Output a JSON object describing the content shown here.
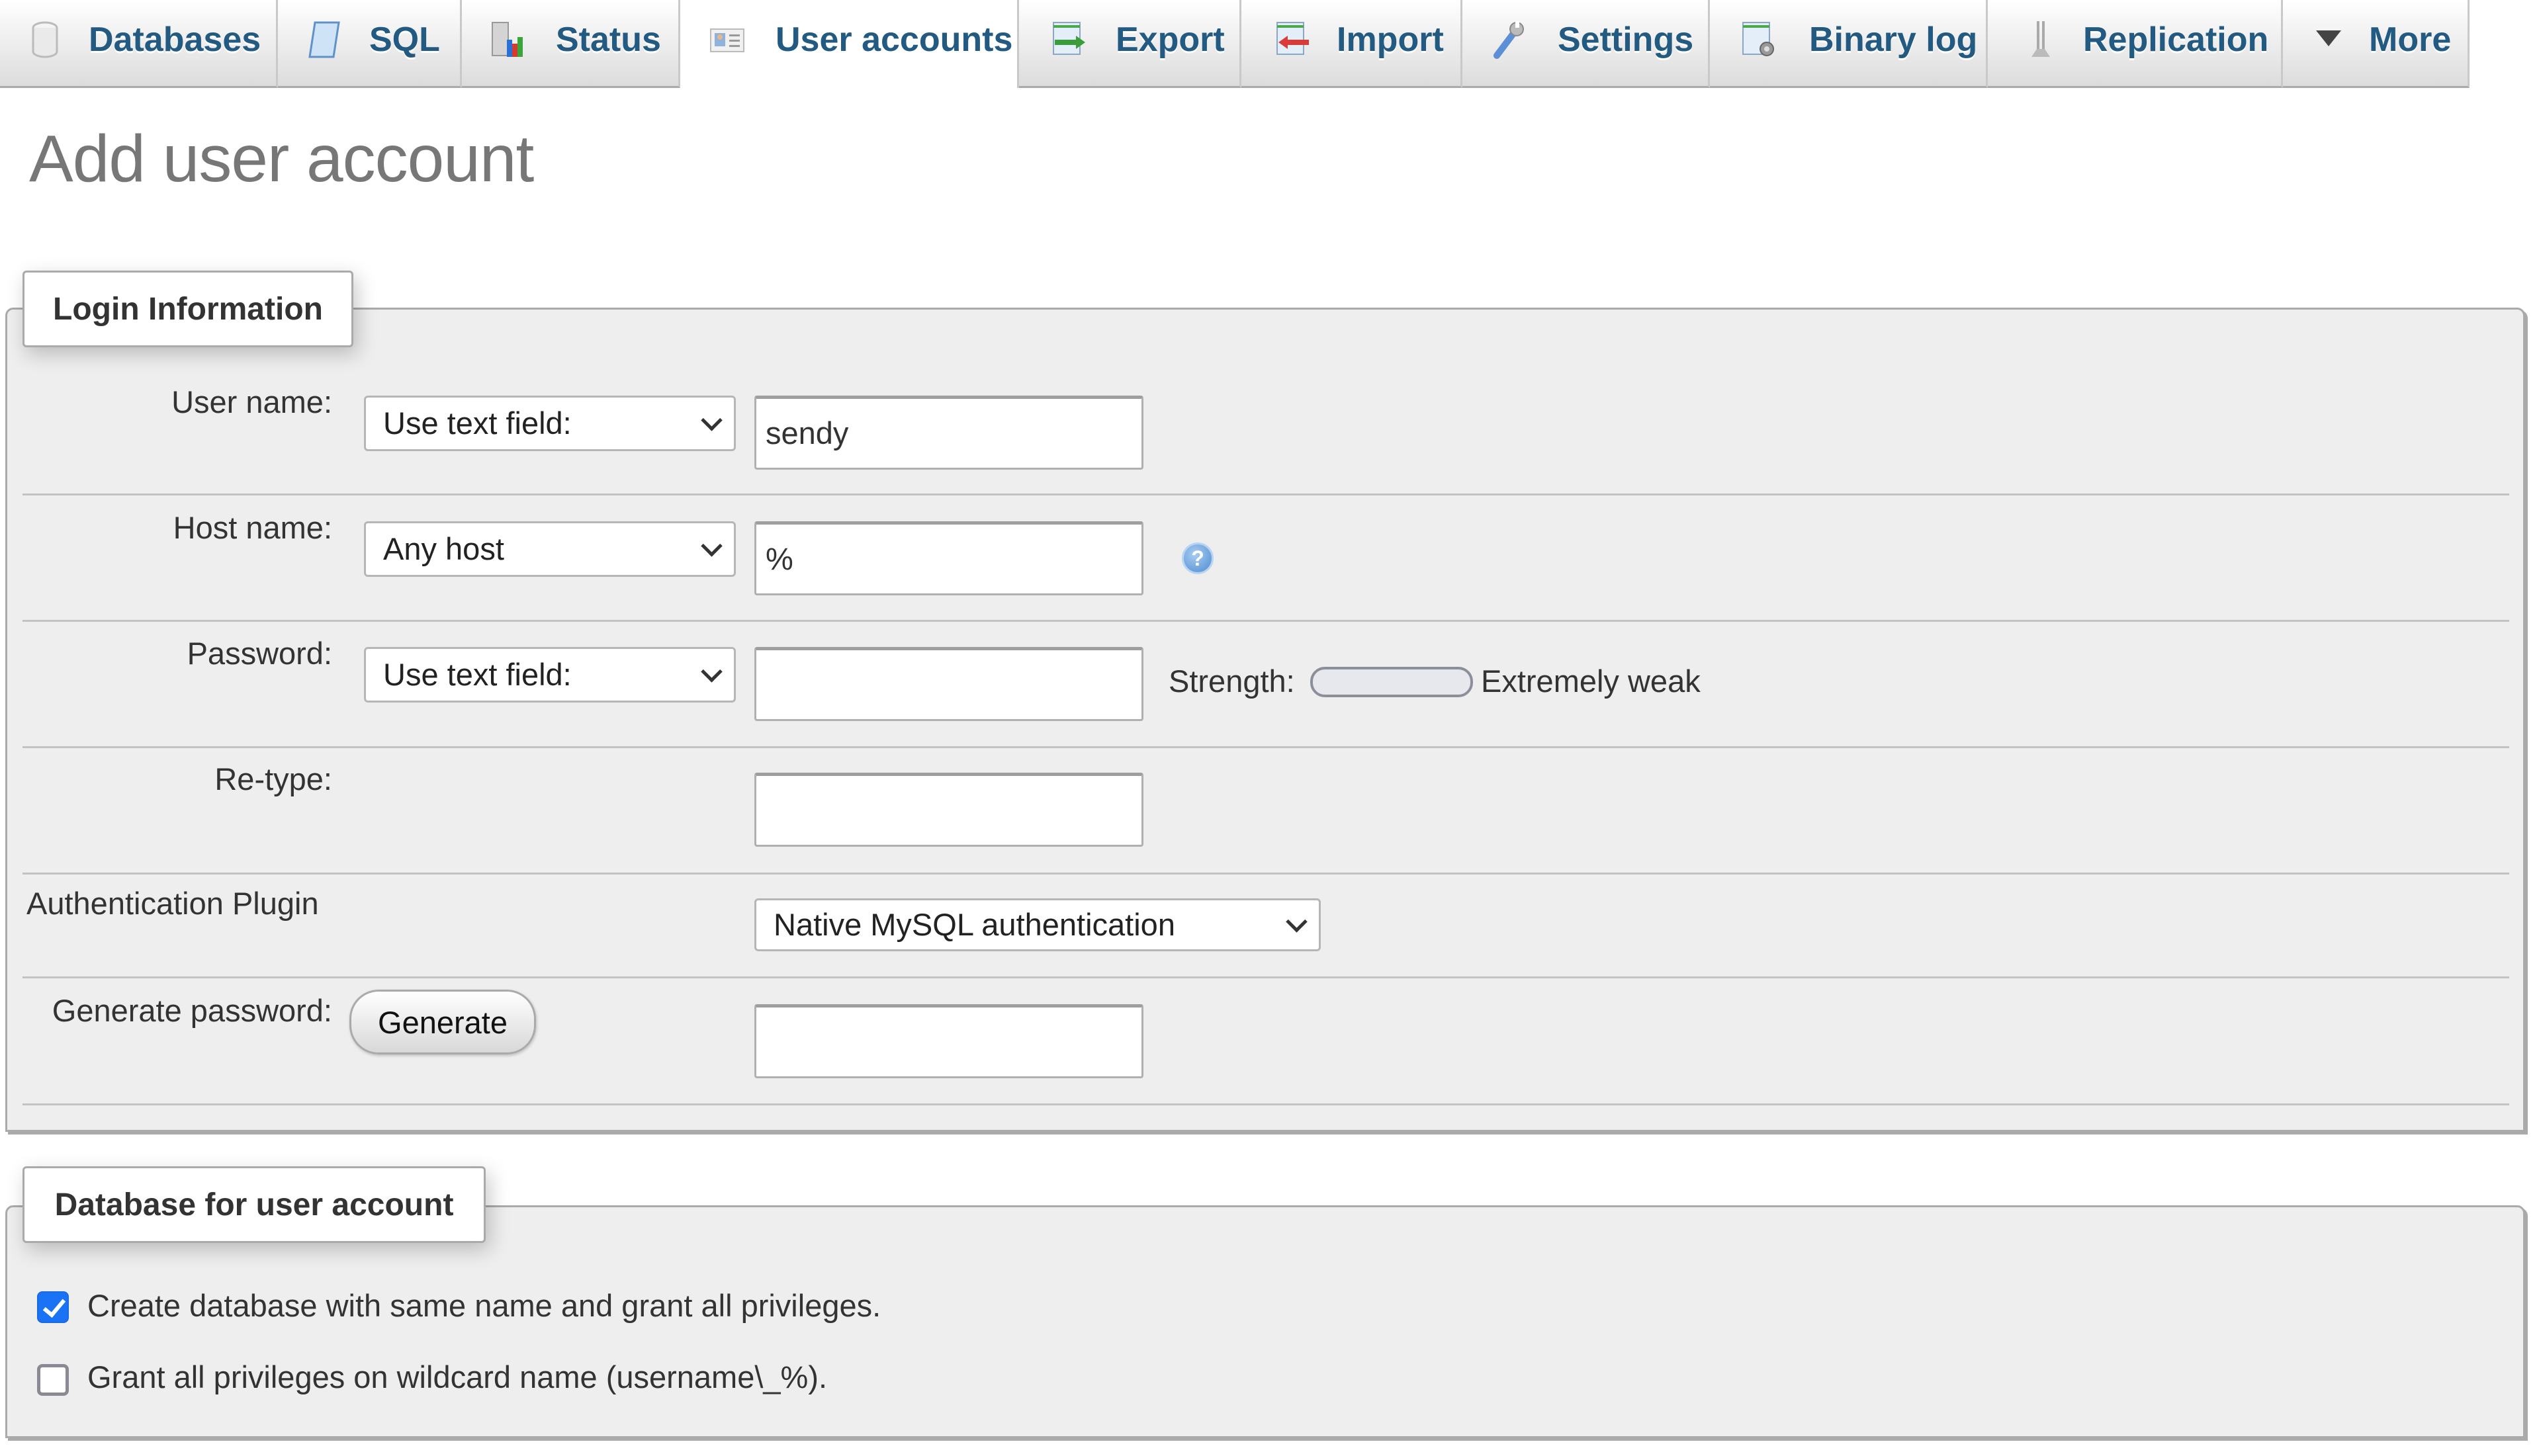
{
  "tabs": [
    {
      "label": "Databases",
      "icon": "database-icon",
      "active": false
    },
    {
      "label": "SQL",
      "icon": "sql-scroll-icon",
      "active": false
    },
    {
      "label": "Status",
      "icon": "status-chart-icon",
      "active": false
    },
    {
      "label": "User accounts",
      "icon": "user-card-icon",
      "active": true
    },
    {
      "label": "Export",
      "icon": "export-icon",
      "active": false
    },
    {
      "label": "Import",
      "icon": "import-icon",
      "active": false
    },
    {
      "label": "Settings",
      "icon": "wrench-icon",
      "active": false
    },
    {
      "label": "Binary log",
      "icon": "binary-log-icon",
      "active": false
    },
    {
      "label": "Replication",
      "icon": "replication-icon",
      "active": false
    },
    {
      "label": "More",
      "icon": "triangle-down-icon",
      "active": false
    }
  ],
  "page_title": "Add user account",
  "login": {
    "legend": "Login Information",
    "user_name": {
      "label": "User name:",
      "select": "Use text field:",
      "value": "sendy"
    },
    "host_name": {
      "label": "Host name:",
      "select": "Any host",
      "value": "%",
      "help_icon": "?"
    },
    "password": {
      "label": "Password:",
      "select": "Use text field:",
      "value": "",
      "strength_label": "Strength:",
      "strength_text": "Extremely weak",
      "strength_fraction": 0
    },
    "retype": {
      "label": "Re-type:",
      "value": ""
    },
    "auth_plugin": {
      "label": "Authentication Plugin",
      "select": "Native MySQL authentication"
    },
    "generate": {
      "label": "Generate password:",
      "button": "Generate",
      "value": ""
    }
  },
  "database": {
    "legend": "Database for user account",
    "options": [
      {
        "label": "Create database with same name and grant all privileges.",
        "checked": true
      },
      {
        "label": "Grant all privileges on wildcard name (username\\_%).",
        "checked": false
      }
    ]
  }
}
